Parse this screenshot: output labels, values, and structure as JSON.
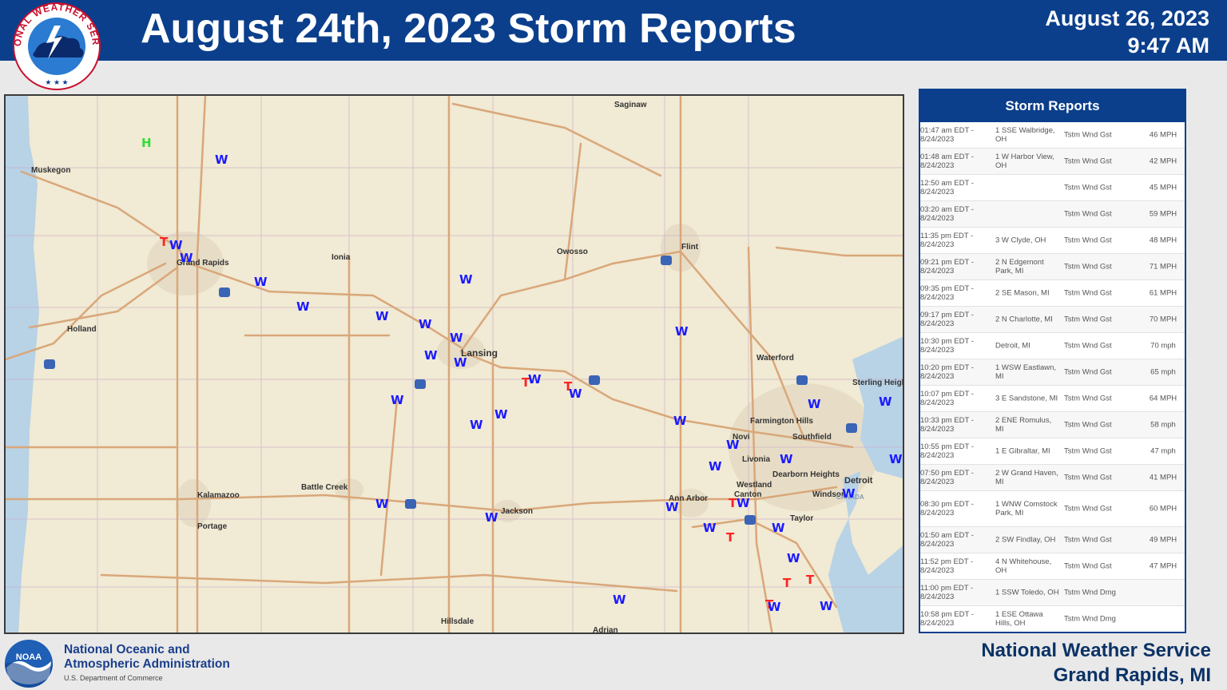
{
  "header": {
    "title": "August 24th, 2023 Storm Reports",
    "date": "August 26, 2023",
    "time": "9:47 AM",
    "logo_text": "NATIONAL WEATHER SERVICE"
  },
  "panel": {
    "title": "Storm Reports",
    "rows": [
      {
        "time": "01:47 am EDT - 8/24/2023",
        "location": "1 SSE Walbridge, OH",
        "type": "Tstm Wnd Gst",
        "mag": "46 MPH"
      },
      {
        "time": "01:48 am EDT - 8/24/2023",
        "location": "1 W Harbor View, OH",
        "type": "Tstm Wnd Gst",
        "mag": "42 MPH"
      },
      {
        "time": "12:50 am EDT - 8/24/2023",
        "location": "",
        "type": "Tstm Wnd Gst",
        "mag": "45 MPH"
      },
      {
        "time": "03:20 am EDT - 8/24/2023",
        "location": "",
        "type": "Tstm Wnd Gst",
        "mag": "59 MPH"
      },
      {
        "time": "11:35 pm EDT - 8/24/2023",
        "location": "3 W Clyde, OH",
        "type": "Tstm Wnd Gst",
        "mag": "48 MPH"
      },
      {
        "time": "09:21 pm EDT - 8/24/2023",
        "location": "2 N Edgemont Park, MI",
        "type": "Tstm Wnd Gst",
        "mag": "71 MPH"
      },
      {
        "time": "09:35 pm EDT - 8/24/2023",
        "location": "2 SE Mason, MI",
        "type": "Tstm Wnd Gst",
        "mag": "61 MPH"
      },
      {
        "time": "09:17 pm EDT - 8/24/2023",
        "location": "2 N Charlotte, MI",
        "type": "Tstm Wnd Gst",
        "mag": "70 MPH"
      },
      {
        "time": "10:30 pm EDT - 8/24/2023",
        "location": "Detroit, MI",
        "type": "Tstm Wnd Gst",
        "mag": "70 mph"
      },
      {
        "time": "10:20 pm EDT - 8/24/2023",
        "location": "1 WSW Eastlawn, MI",
        "type": "Tstm Wnd Gst",
        "mag": "65 mph"
      },
      {
        "time": "10:07 pm EDT - 8/24/2023",
        "location": "3 E Sandstone, MI",
        "type": "Tstm Wnd Gst",
        "mag": "64 MPH"
      },
      {
        "time": "10:33 pm EDT - 8/24/2023",
        "location": "2 ENE Romulus, MI",
        "type": "Tstm Wnd Gst",
        "mag": "58 mph"
      },
      {
        "time": "10:55 pm EDT - 8/24/2023",
        "location": "1 E Gibraltar, MI",
        "type": "Tstm Wnd Gst",
        "mag": "47 mph"
      },
      {
        "time": "07:50 pm EDT - 8/24/2023",
        "location": "2 W Grand Haven, MI",
        "type": "Tstm Wnd Gst",
        "mag": "41 MPH"
      },
      {
        "time": "08:30 pm EDT - 8/24/2023",
        "location": "1 WNW Comstock Park, MI",
        "type": "Tstm Wnd Gst",
        "mag": "60 MPH"
      },
      {
        "time": "01:50 am EDT - 8/24/2023",
        "location": "2 SW Findlay, OH",
        "type": "Tstm Wnd Gst",
        "mag": "49 MPH"
      },
      {
        "time": "11:52 pm EDT - 8/24/2023",
        "location": "4 N Whitehouse, OH",
        "type": "Tstm Wnd Gst",
        "mag": "47 MPH"
      },
      {
        "time": "11:00 pm EDT - 8/24/2023",
        "location": "1 SSW Toledo, OH",
        "type": "Tstm Wnd Dmg",
        "mag": ""
      },
      {
        "time": "10:58 pm EDT - 8/24/2023",
        "location": "1 ESE Ottawa Hills, OH",
        "type": "Tstm Wnd Dmg",
        "mag": ""
      }
    ]
  },
  "map": {
    "cities": [
      "Saginaw",
      "Muskegon",
      "Grand Rapids",
      "Ionia",
      "Owosso",
      "Flint",
      "Holland",
      "Lansing",
      "Waterford",
      "Sterling Heights",
      "Farmington Hills",
      "Novi",
      "Southfield",
      "Livonia",
      "Dearborn Heights",
      "Westland",
      "Canton",
      "Detroit",
      "Windsor",
      "Taylor",
      "Kalamazoo",
      "Portage",
      "Battle Creek",
      "Jackson",
      "Ann Arbor",
      "Hillsdale",
      "Adrian",
      "CANADA"
    ],
    "marker_legend": {
      "W": "wind",
      "T": "tree damage",
      "H": "hail"
    },
    "colors": {
      "wind": "#1a1aff",
      "tree": "#ff2222",
      "hail": "#33dd33",
      "land": "#f1ead4",
      "water": "#b8d2e6",
      "road": "#d9a77a"
    }
  },
  "footer": {
    "org_line1": "National Oceanic and",
    "org_line2": "Atmospheric Administration",
    "org_sub": "U.S. Department of Commerce",
    "logo_text": "NOAA",
    "office_line1": "National Weather Service",
    "office_line2": "Grand Rapids, MI"
  }
}
